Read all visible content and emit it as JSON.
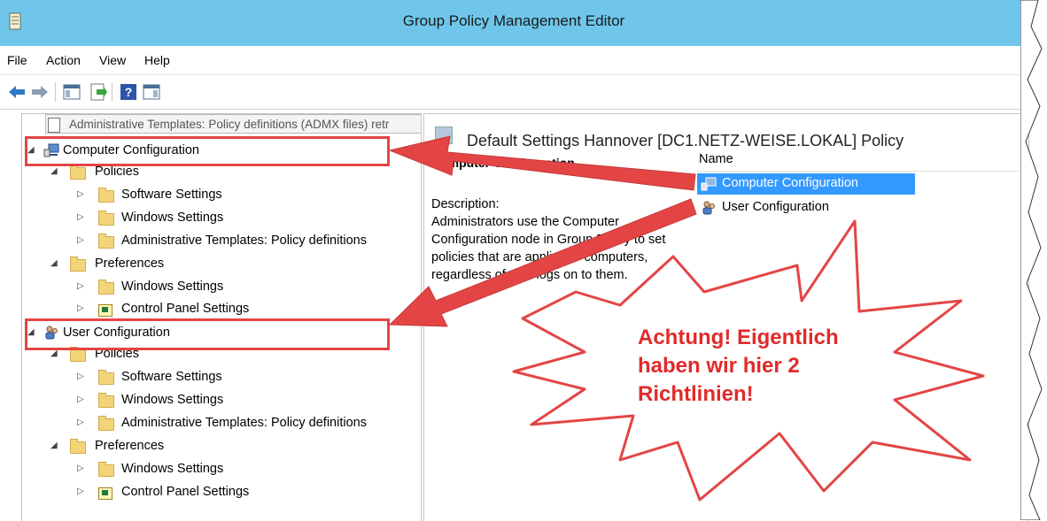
{
  "window": {
    "title": "Group Policy Management Editor"
  },
  "menu": [
    "File",
    "Action",
    "View",
    "Help"
  ],
  "toolbar": {
    "icons": [
      "back-arrow-icon",
      "forward-arrow-icon",
      "show-hide-console-tree-icon",
      "export-list-icon",
      "help-icon",
      "show-action-pane-icon"
    ]
  },
  "tooltip": "Administrative Templates: Policy definitions (ADMX files) retr",
  "tree": {
    "computer_configuration": "Computer Configuration",
    "policies": "Policies",
    "software_settings": "Software Settings",
    "windows_settings": "Windows Settings",
    "admin_templates": "Administrative Templates: Policy definitions",
    "preferences": "Preferences",
    "pref_windows_settings": "Windows Settings",
    "control_panel_settings": "Control Panel Settings",
    "user_configuration": "User Configuration",
    "u_policies": "Policies",
    "u_software_settings": "Software Settings",
    "u_windows_settings": "Windows Settings",
    "u_admin_templates": "Administrative Templates: Policy definitions",
    "u_preferences": "Preferences",
    "u_pref_windows_settings": "Windows Settings",
    "u_control_panel_settings": "Control Panel Settings"
  },
  "right": {
    "policy_title": "Default Settings Hannover [DC1.NETZ-WEISE.LOKAL] Policy",
    "desc_title": "Computer Configuration",
    "desc_label": "Description:",
    "desc_text": "Administrators use the Computer Configuration node in Group Policy to set policies that are applied to computers, regardless of who logs on to them.",
    "column_name": "Name",
    "items": [
      "Computer Configuration",
      "User Configuration"
    ]
  },
  "annotation": {
    "callout": "Achtung! Eigentlich haben wir hier 2 Richtlinien!",
    "colors": {
      "callout_red": "#e12a2a",
      "box_red": "#e34545",
      "arrow_red": "#e34545",
      "selection_blue": "#3399ff",
      "titlebar_blue": "#6fc6ea"
    }
  }
}
